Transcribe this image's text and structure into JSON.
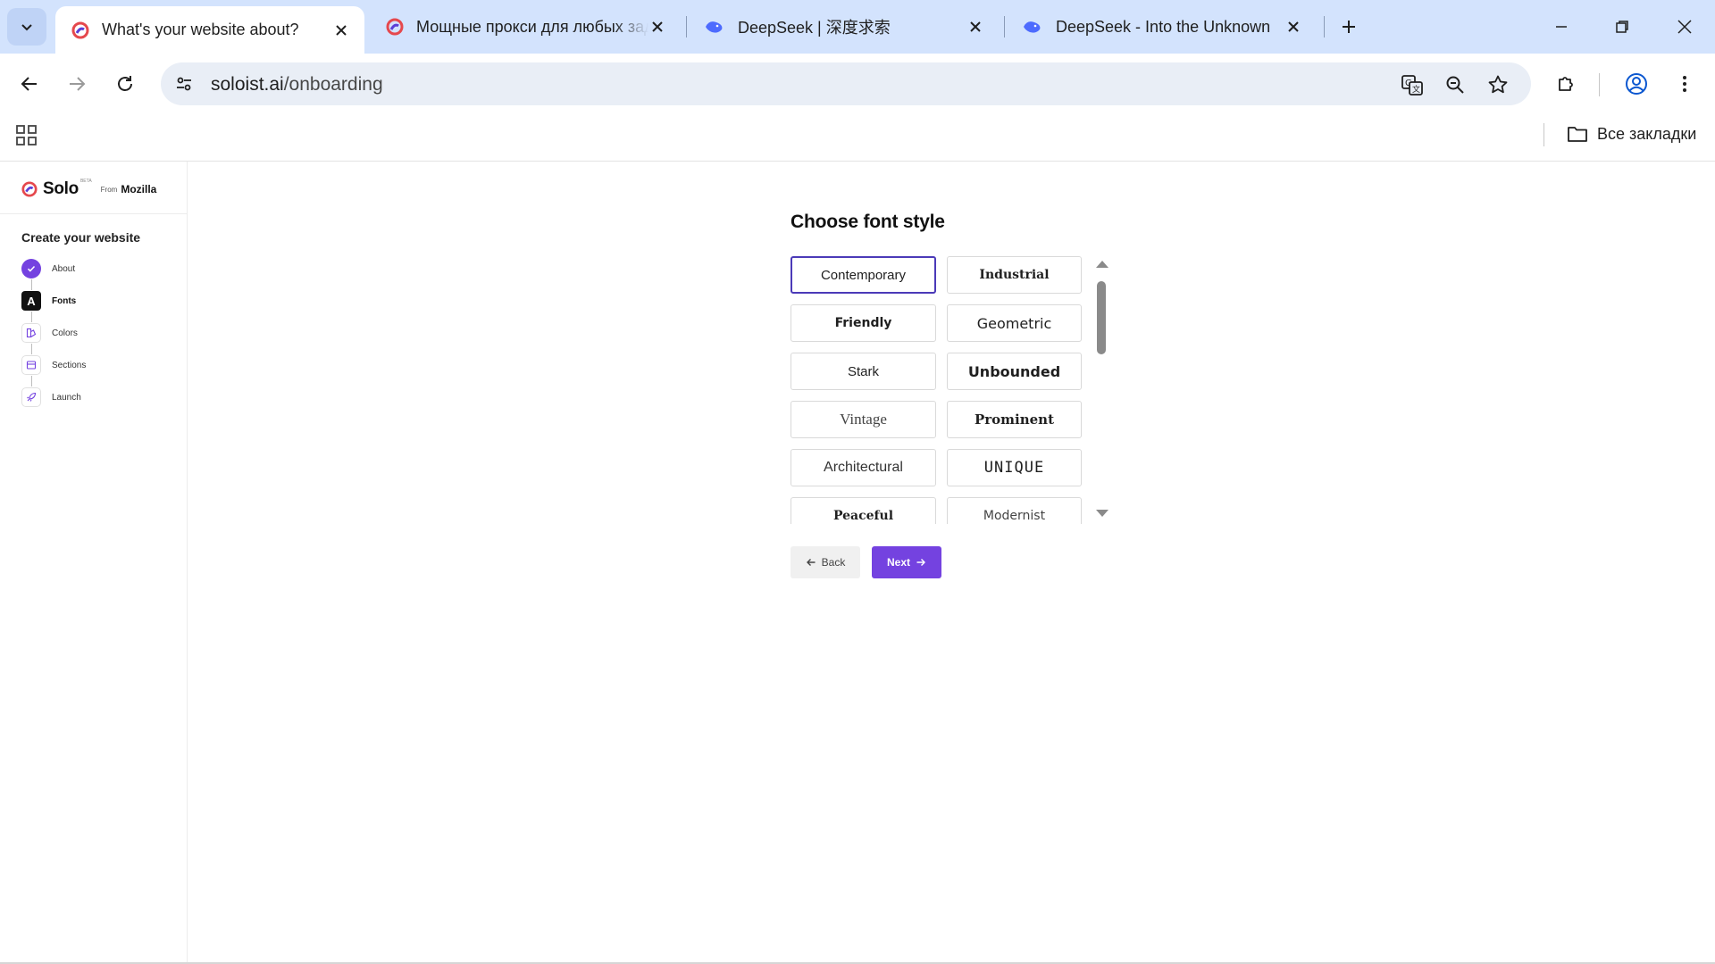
{
  "browser": {
    "tabs": [
      {
        "title": "What's your website about?",
        "active": true
      },
      {
        "title": "Мощные прокси для любых задач",
        "active": false
      },
      {
        "title": "DeepSeek | 深度求索",
        "active": false
      },
      {
        "title": "DeepSeek - Into the Unknown",
        "active": false
      }
    ],
    "url_host": "soloist.ai",
    "url_path": "/onboarding",
    "bookmarks_all_label": "Все закладки"
  },
  "sidebar": {
    "logo": "Solo",
    "beta": "BETA",
    "from": "From",
    "mozilla": "Mozilla",
    "heading": "Create your website",
    "steps": [
      {
        "label": "About",
        "state": "done"
      },
      {
        "label": "Fonts",
        "state": "current",
        "glyph": "A"
      },
      {
        "label": "Colors",
        "state": "todo"
      },
      {
        "label": "Sections",
        "state": "todo"
      },
      {
        "label": "Launch",
        "state": "todo"
      }
    ]
  },
  "main": {
    "heading": "Choose font style",
    "fonts": [
      {
        "label": "Contemporary",
        "selected": true
      },
      {
        "label": "Industrial",
        "selected": false
      },
      {
        "label": "Friendly",
        "selected": false
      },
      {
        "label": "Geometric",
        "selected": false
      },
      {
        "label": "Stark",
        "selected": false
      },
      {
        "label": "Unbounded",
        "selected": false
      },
      {
        "label": "Vintage",
        "selected": false
      },
      {
        "label": "Prominent",
        "selected": false
      },
      {
        "label": "Architectural",
        "selected": false
      },
      {
        "label": "UNIQUE",
        "selected": false
      },
      {
        "label": "Peaceful",
        "selected": false
      },
      {
        "label": "Modernist",
        "selected": false
      }
    ],
    "back_label": "Back",
    "next_label": "Next"
  },
  "colors": {
    "accent": "#7442e0",
    "selected_border": "#4b3ab8",
    "tabbar": "#d3e3fd"
  }
}
